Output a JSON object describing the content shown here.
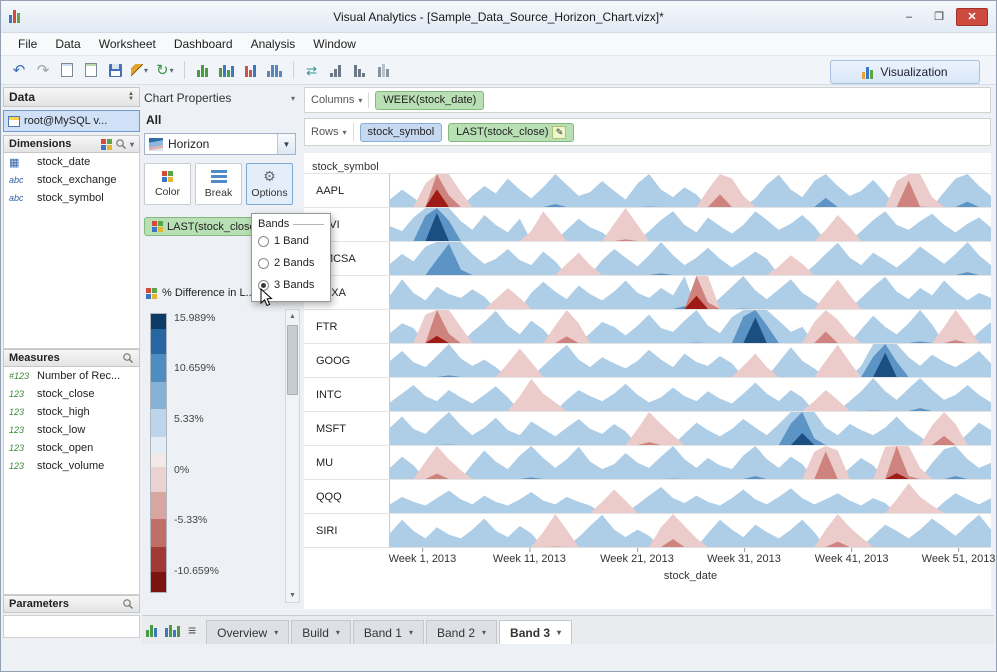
{
  "window": {
    "title": "Visual Analytics - [Sample_Data_Source_Horizon_Chart.vizx]*",
    "controls": {
      "minimize": "–",
      "maximize": "❐",
      "close": "✕"
    }
  },
  "menu": {
    "items": [
      "File",
      "Data",
      "Worksheet",
      "Dashboard",
      "Analysis",
      "Window"
    ]
  },
  "toolbar": {
    "visualization_label": "Visualization"
  },
  "data_panel": {
    "header": "Data",
    "connection": {
      "label": "root@MySQL v..."
    },
    "dimensions": {
      "header": "Dimensions",
      "items": [
        {
          "icon_text": "▦",
          "label": "stock_date"
        },
        {
          "icon_text": "abc",
          "label": "stock_exchange"
        },
        {
          "icon_text": "abc",
          "label": "stock_symbol"
        }
      ]
    },
    "measures": {
      "header": "Measures",
      "items": [
        {
          "icon_text": "#123",
          "label": "Number of Rec..."
        },
        {
          "icon_text": "123",
          "label": "stock_close"
        },
        {
          "icon_text": "123",
          "label": "stock_high"
        },
        {
          "icon_text": "123",
          "label": "stock_low"
        },
        {
          "icon_text": "123",
          "label": "stock_open"
        },
        {
          "icon_text": "123",
          "label": "stock_volume"
        }
      ]
    },
    "parameters": {
      "header": "Parameters"
    }
  },
  "properties_panel": {
    "header": "Chart Properties",
    "scope_label": "All",
    "chart_type": "Horizon",
    "buttons": [
      {
        "label": "Color"
      },
      {
        "label": "Break"
      },
      {
        "label": "Options"
      }
    ],
    "encoding_pill": "LAST(stock_close)",
    "legend": {
      "title": "% Difference in L...",
      "labels": [
        "15.989%",
        "10.659%",
        "5.33%",
        "0%",
        "-5.33%",
        "-10.659%"
      ],
      "label_values": [
        15.989,
        10.659,
        5.33,
        0,
        -5.33,
        -10.659
      ],
      "segments": [
        {
          "color": "#0e3a66",
          "weight": 6
        },
        {
          "color": "#2566a3",
          "weight": 10
        },
        {
          "color": "#4f8cc0",
          "weight": 11
        },
        {
          "color": "#86b1d6",
          "weight": 11
        },
        {
          "color": "#bdd5ea",
          "weight": 11
        },
        {
          "color": "#e4edf5",
          "weight": 7
        },
        {
          "color": "#f2e9e8",
          "weight": 5
        },
        {
          "color": "#ead3d1",
          "weight": 10
        },
        {
          "color": "#d8a5a1",
          "weight": 11
        },
        {
          "color": "#c06e68",
          "weight": 11
        },
        {
          "color": "#a03a34",
          "weight": 10
        },
        {
          "color": "#7b1410",
          "weight": 8
        }
      ]
    }
  },
  "popup": {
    "title": "Bands",
    "options": [
      {
        "label": "1 Band",
        "selected": false
      },
      {
        "label": "2 Bands",
        "selected": false
      },
      {
        "label": "3 Bands",
        "selected": true
      }
    ]
  },
  "shelves": {
    "columns_label": "Columns",
    "columns_pills": [
      {
        "label": "WEEK(stock_date)"
      }
    ],
    "rows_label": "Rows",
    "rows_pills": [
      {
        "label": "stock_symbol"
      },
      {
        "label": "LAST(stock_close)"
      }
    ]
  },
  "tabs": {
    "items": [
      {
        "label": "Overview",
        "active": false
      },
      {
        "label": "Build",
        "active": false
      },
      {
        "label": "Band 1",
        "active": false
      },
      {
        "label": "Band 2",
        "active": false
      },
      {
        "label": "Band 3",
        "active": true
      }
    ]
  },
  "chart_data": {
    "type": "horizon",
    "row_header": "stock_symbol",
    "xlabel": "stock_date",
    "bands": 3,
    "band_size_pct": 5.33,
    "x_ticks": [
      "Week 1, 2013",
      "Week 11, 2013",
      "Week 21, 2013",
      "Week 31, 2013",
      "Week 41, 2013",
      "Week 51, 2013"
    ],
    "x_tick_weeks": [
      1,
      11,
      21,
      31,
      41,
      51
    ],
    "colors": {
      "pos": [
        "#aecde6",
        "#5b94c5",
        "#1b4f82"
      ],
      "neg": [
        "#ecccca",
        "#cf837e",
        "#9e1b16"
      ]
    },
    "series": [
      {
        "name": "AAPL",
        "values": [
          1.2,
          2.8,
          1.5,
          -3.8,
          -13.5,
          -7.2,
          -2.4,
          1.8,
          3.4,
          2.2,
          4.6,
          2.8,
          1.4,
          3.2,
          5.8,
          3.6,
          1.8,
          2.4,
          4.2,
          2.6,
          1.2,
          3.8,
          5.4,
          2.8,
          1.6,
          3.2,
          2.0,
          -2.8,
          -7.4,
          -4.6,
          -1.8,
          1.4,
          3.6,
          5.2,
          2.8,
          1.6,
          4.2,
          6.8,
          3.4,
          1.8,
          2.6,
          4.4,
          2.2,
          -4.2,
          -9.6,
          -5.4,
          -1.6,
          2.4,
          4.6,
          6.2,
          3.4,
          1.8
        ]
      },
      {
        "name": "ATVI",
        "values": [
          2.4,
          1.6,
          3.8,
          9.4,
          15.2,
          8.6,
          3.2,
          1.8,
          4.2,
          2.6,
          1.4,
          3.6,
          -1.6,
          -4.8,
          -2.4,
          1.8,
          3.6,
          2.2,
          1.4,
          -2.8,
          -5.6,
          -2.6,
          1.6,
          3.4,
          4.8,
          2.6,
          1.4,
          3.8,
          2.4,
          1.2,
          2.6,
          4.8,
          3.4,
          1.8,
          2.8,
          4.2,
          2.4,
          -1.8,
          -4.2,
          -2.2,
          1.6,
          3.4,
          4.8,
          2.6,
          1.8,
          3.2,
          4.4,
          2.6,
          1.4,
          2.8,
          3.8,
          2.2
        ]
      },
      {
        "name": "CMCSA",
        "values": [
          1.8,
          3.4,
          2.2,
          4.6,
          7.8,
          10.4,
          6.2,
          3.4,
          1.8,
          2.6,
          4.2,
          2.4,
          1.6,
          3.8,
          2.2,
          -1.8,
          -3.6,
          -1.6,
          2.4,
          4.2,
          2.8,
          1.4,
          3.2,
          5.6,
          3.2,
          1.6,
          2.8,
          4.4,
          2.6,
          1.2,
          2.4,
          3.8,
          2.6,
          -1.4,
          -3.2,
          -1.8,
          1.6,
          3.4,
          5.2,
          2.8,
          1.6,
          3.6,
          2.4,
          1.2,
          2.8,
          4.6,
          3.2,
          1.8,
          3.4,
          5.8,
          3.2,
          1.6
        ]
      },
      {
        "name": "FOXA",
        "values": [
          2.2,
          4.8,
          2.6,
          1.4,
          3.6,
          2.4,
          1.8,
          3.2,
          2.0,
          -1.6,
          -3.4,
          -1.8,
          2.6,
          4.4,
          2.8,
          1.6,
          3.8,
          2.4,
          1.4,
          2.8,
          4.6,
          2.6,
          1.8,
          3.4,
          2.2,
          5.8,
          -12.8,
          -6.4,
          1.8,
          3.6,
          5.4,
          3.0,
          1.6,
          3.2,
          4.8,
          2.6,
          1.4,
          -2.4,
          -4.8,
          -2.2,
          1.8,
          3.6,
          5.2,
          2.8,
          1.6,
          3.4,
          2.2,
          4.6,
          2.8,
          1.4,
          2.6,
          1.8
        ]
      },
      {
        "name": "FTR",
        "values": [
          1.6,
          3.2,
          2.4,
          -4.6,
          -11.8,
          -6.8,
          -2.6,
          1.8,
          3.4,
          5.2,
          2.8,
          1.4,
          3.6,
          2.2,
          -2.8,
          -6.4,
          -3.2,
          1.6,
          3.4,
          2.6,
          1.2,
          2.8,
          4.6,
          2.4,
          1.8,
          3.6,
          5.4,
          2.8,
          1.6,
          4.2,
          9.6,
          14.8,
          8.2,
          3.6,
          1.8,
          2.6,
          -3.4,
          -7.2,
          -3.8,
          -1.4,
          2.2,
          4.4,
          2.6,
          1.4,
          3.2,
          5.6,
          3.0,
          -2.6,
          -5.8,
          -2.8,
          1.8,
          3.4
        ]
      },
      {
        "name": "GOOG",
        "values": [
          2.6,
          4.2,
          2.4,
          1.6,
          3.4,
          5.6,
          3.0,
          1.8,
          2.8,
          1.6,
          -2.2,
          -4.6,
          -2.4,
          1.8,
          3.6,
          5.2,
          2.8,
          1.6,
          3.2,
          2.2,
          1.4,
          2.6,
          4.4,
          2.8,
          1.6,
          3.8,
          2.4,
          1.8,
          3.4,
          2.2,
          -1.8,
          -3.8,
          -1.6,
          2.4,
          4.8,
          2.6,
          1.4,
          -2.6,
          -5.2,
          -2.4,
          1.8,
          8.6,
          14.6,
          7.8,
          3.2,
          1.8,
          3.6,
          2.4,
          1.6,
          2.8,
          4.2,
          2.2
        ]
      },
      {
        "name": "INTC",
        "values": [
          1.4,
          2.8,
          4.2,
          2.4,
          1.6,
          3.4,
          2.2,
          1.2,
          2.6,
          4.0,
          2.2,
          -2.4,
          -5.2,
          -2.8,
          -1.4,
          1.8,
          3.4,
          2.4,
          1.6,
          2.8,
          4.4,
          2.6,
          1.4,
          2.2,
          3.8,
          2.4,
          1.6,
          3.2,
          2.0,
          1.2,
          2.8,
          4.6,
          2.8,
          1.6,
          3.4,
          2.2,
          -1.6,
          -3.4,
          -1.8,
          1.6,
          3.2,
          5.4,
          3.2,
          1.8,
          3.6,
          5.8,
          3.4,
          1.8,
          2.6,
          4.2,
          2.6,
          1.4
        ]
      },
      {
        "name": "MSFT",
        "values": [
          2.8,
          4.6,
          2.6,
          1.8,
          3.6,
          5.4,
          3.2,
          1.6,
          2.8,
          4.4,
          2.4,
          1.6,
          3.8,
          2.6,
          1.4,
          2.8,
          4.2,
          2.6,
          1.8,
          3.4,
          2.2,
          -2.6,
          -5.8,
          -3.4,
          -1.6,
          1.8,
          3.6,
          2.4,
          1.4,
          2.6,
          4.2,
          2.8,
          1.6,
          3.4,
          8.8,
          12.6,
          6.4,
          2.8,
          1.6,
          3.4,
          2.4,
          1.6,
          2.8,
          4.6,
          2.6,
          1.4,
          -3.2,
          -6.8,
          -3.4,
          1.8,
          3.6,
          2.4
        ]
      },
      {
        "name": "MU",
        "values": [
          1.8,
          3.6,
          2.2,
          -2.8,
          -6.2,
          -3.2,
          -1.4,
          2.4,
          4.6,
          2.8,
          1.6,
          3.8,
          5.6,
          3.4,
          1.8,
          3.2,
          5.2,
          2.8,
          1.6,
          2.4,
          4.2,
          2.6,
          1.8,
          3.6,
          5.4,
          3.2,
          1.8,
          3.4,
          2.2,
          1.6,
          3.8,
          5.8,
          3.2,
          1.8,
          3.6,
          2.4,
          -4.4,
          -9.8,
          -4.6,
          1.8,
          3.4,
          2.2,
          -5.2,
          -11.6,
          -5.8,
          -1.8,
          2.6,
          4.8,
          5.8,
          3.2,
          1.8,
          2.6
        ]
      },
      {
        "name": "QQQ",
        "values": [
          1.4,
          2.6,
          1.8,
          1.2,
          2.4,
          3.6,
          2.2,
          1.4,
          2.8,
          1.8,
          1.2,
          2.2,
          3.4,
          2.0,
          1.4,
          2.6,
          1.8,
          1.2,
          -1.8,
          -3.8,
          -2.0,
          1.4,
          2.8,
          4.2,
          2.4,
          1.6,
          2.8,
          1.8,
          1.2,
          2.4,
          3.8,
          2.2,
          1.4,
          2.6,
          4.0,
          2.4,
          1.4,
          2.2,
          3.2,
          2.0,
          1.2,
          2.4,
          1.6,
          -2.2,
          -4.8,
          -2.6,
          -1.2,
          1.8,
          3.2,
          2.2,
          1.4,
          2.4
        ]
      },
      {
        "name": "SIRI",
        "values": [
          2.2,
          4.4,
          2.6,
          1.4,
          3.2,
          2.0,
          1.4,
          2.8,
          4.6,
          2.6,
          1.6,
          3.4,
          2.2,
          -2.4,
          -5.4,
          -2.8,
          1.6,
          3.4,
          5.2,
          2.8,
          1.6,
          2.8,
          1.8,
          -3.2,
          -6.6,
          -3.4,
          -1.4,
          2.2,
          4.4,
          2.8,
          1.6,
          3.6,
          2.4,
          1.4,
          2.8,
          4.4,
          2.4,
          -2.8,
          -6.2,
          -3.2,
          -1.6,
          1.8,
          3.6,
          2.6,
          1.4,
          2.8,
          4.6,
          3.2,
          1.8,
          3.6,
          5.2,
          2.8
        ]
      }
    ]
  }
}
